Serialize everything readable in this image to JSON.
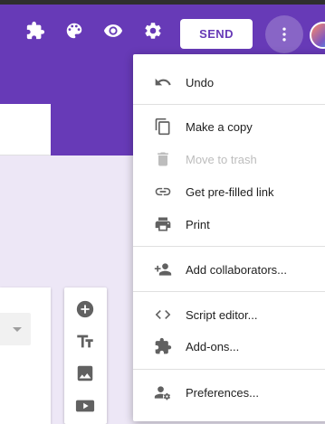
{
  "header": {
    "send_label": "SEND",
    "icons": [
      "addons-icon",
      "palette-icon",
      "preview-eye-icon",
      "settings-gear-icon",
      "more-vert-icon"
    ]
  },
  "menu": {
    "items": [
      {
        "label": "Undo",
        "icon": "undo-icon",
        "enabled": true
      },
      {
        "label": "Make a copy",
        "icon": "copy-icon",
        "enabled": true
      },
      {
        "label": "Move to trash",
        "icon": "trash-icon",
        "enabled": false
      },
      {
        "label": "Get pre-filled link",
        "icon": "link-icon",
        "enabled": true,
        "highlighted": true
      },
      {
        "label": "Print",
        "icon": "print-icon",
        "enabled": true
      },
      {
        "label": "Add collaborators...",
        "icon": "add-people-icon",
        "enabled": true
      },
      {
        "label": "Script editor...",
        "icon": "code-icon",
        "enabled": true
      },
      {
        "label": "Add-ons...",
        "icon": "puzzle-icon",
        "enabled": true
      },
      {
        "label": "Preferences...",
        "icon": "person-settings-icon",
        "enabled": true
      }
    ]
  },
  "toolbar": {
    "tools": [
      "add-question-icon",
      "add-title-icon",
      "add-image-icon",
      "add-video-icon"
    ]
  },
  "colors": {
    "brand": "#673ab7",
    "background": "#ede7f6",
    "highlight": "#fbff1f"
  }
}
